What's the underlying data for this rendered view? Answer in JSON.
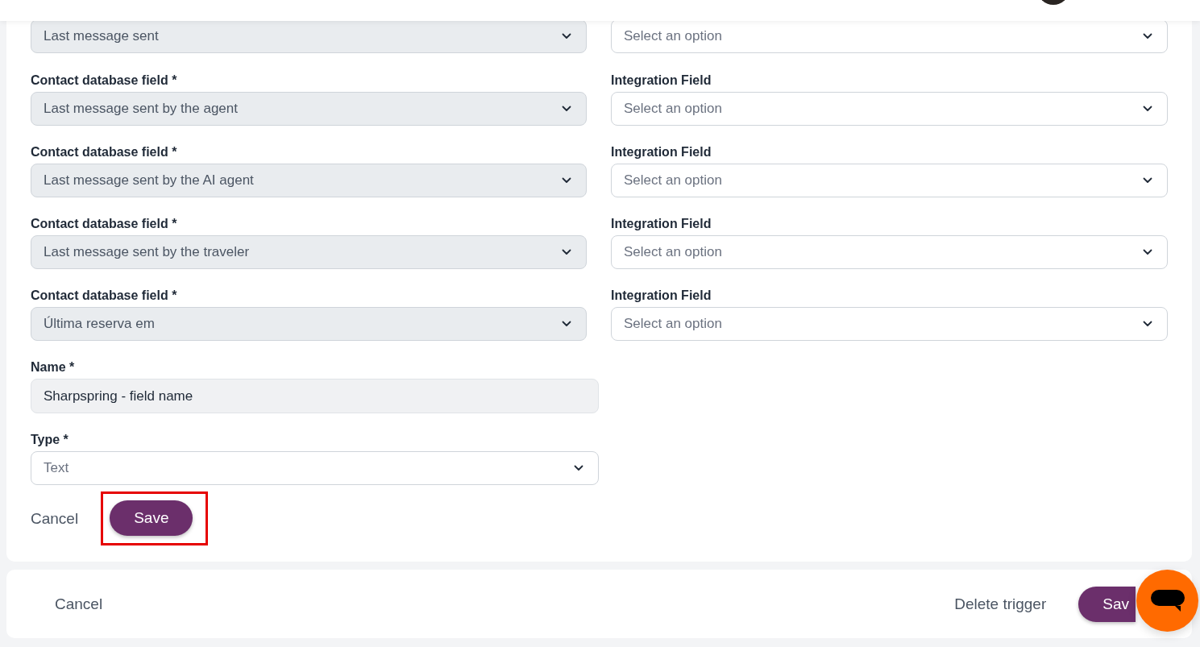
{
  "mappings": [
    {
      "contact_field": {
        "value": "Last message sent",
        "disabled": true
      },
      "integration_field": {
        "placeholder": "Select an option"
      }
    },
    {
      "contact_field": {
        "label": "Contact database field *",
        "value": "Last message sent by the agent",
        "disabled": true
      },
      "integration_field": {
        "label": "Integration Field",
        "placeholder": "Select an option"
      }
    },
    {
      "contact_field": {
        "label": "Contact database field *",
        "value": "Last message sent by the AI agent",
        "disabled": true
      },
      "integration_field": {
        "label": "Integration Field",
        "placeholder": "Select an option"
      }
    },
    {
      "contact_field": {
        "label": "Contact database field *",
        "value": "Last message sent by the traveler",
        "disabled": true
      },
      "integration_field": {
        "label": "Integration Field",
        "placeholder": "Select an option"
      }
    },
    {
      "contact_field": {
        "label": "Contact database field *",
        "value": "Última reserva em",
        "disabled": true
      },
      "integration_field": {
        "label": "Integration Field",
        "placeholder": "Select an option"
      }
    }
  ],
  "name_field": {
    "label": "Name *",
    "value": "Sharpspring - field name"
  },
  "type_field": {
    "label": "Type *",
    "placeholder": "Text"
  },
  "form_actions": {
    "cancel": "Cancel",
    "save": "Save",
    "save_highlighted": true
  },
  "footer": {
    "cancel": "Cancel",
    "delete": "Delete trigger",
    "save": "Sav"
  }
}
